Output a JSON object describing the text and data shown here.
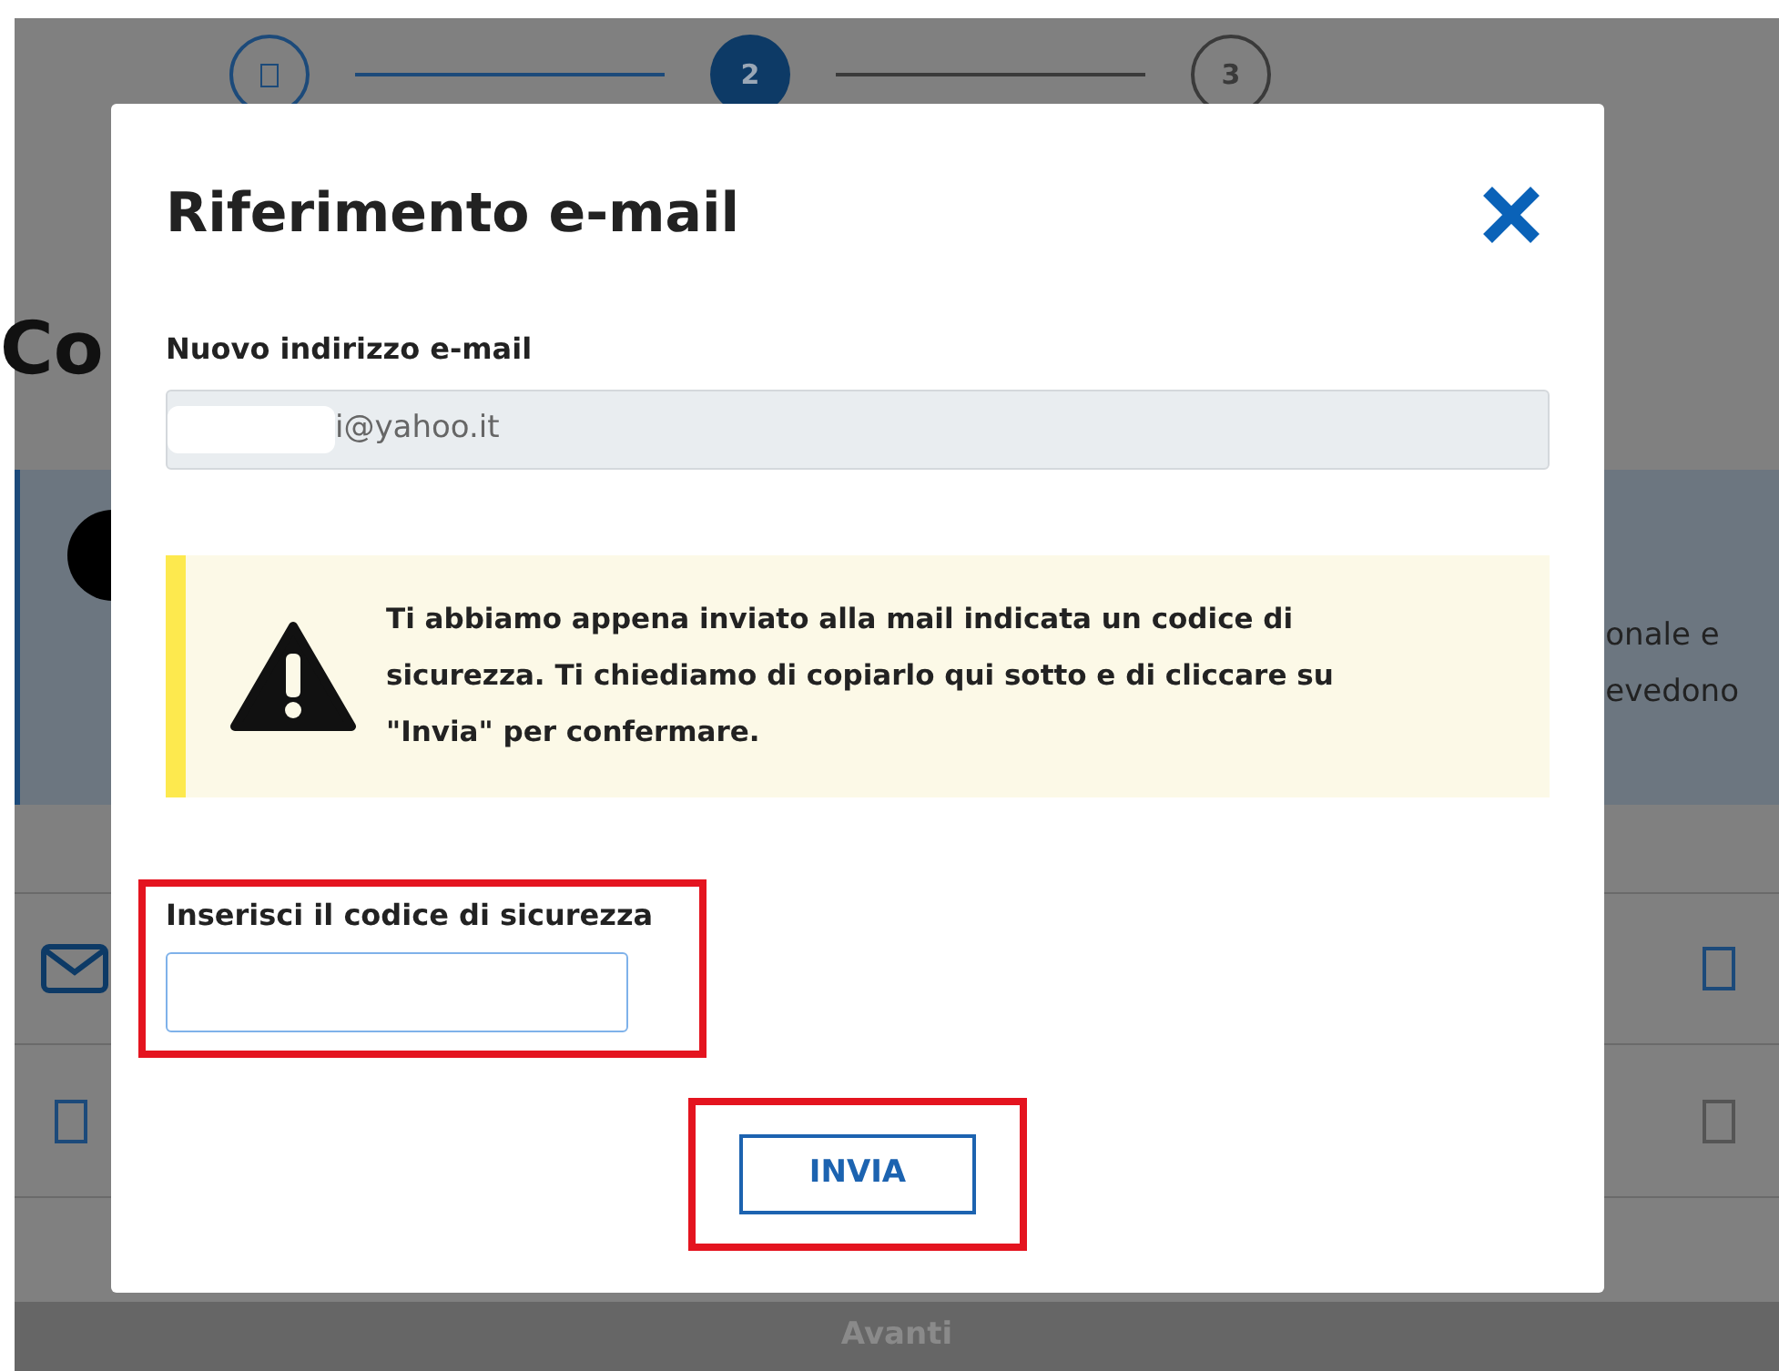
{
  "steps": [
    {
      "done": true,
      "selected": false
    },
    {
      "done": false,
      "selected": true,
      "label": "2"
    },
    {
      "done": false,
      "selected": false,
      "label": "3"
    }
  ],
  "page": {
    "heading": "Co",
    "info_lines": [
      "onale e",
      "evedono"
    ],
    "rows": [
      {
        "checked": false
      },
      {
        "checked": false
      }
    ],
    "next_button": "Avanti"
  },
  "modal": {
    "title": "Riferimento e-mail",
    "email_label": "Nuovo indirizzo e-mail",
    "email_value": "i@yahoo.it",
    "warning": "Ti abbiamo appena inviato alla mail indicata un codice di sicurezza. Ti chiediamo di copiarlo qui sotto e di cliccare su \"Invia\" per confermare.",
    "code_label": "Inserisci il codice di sicurezza",
    "submit_button": "INVIA"
  }
}
